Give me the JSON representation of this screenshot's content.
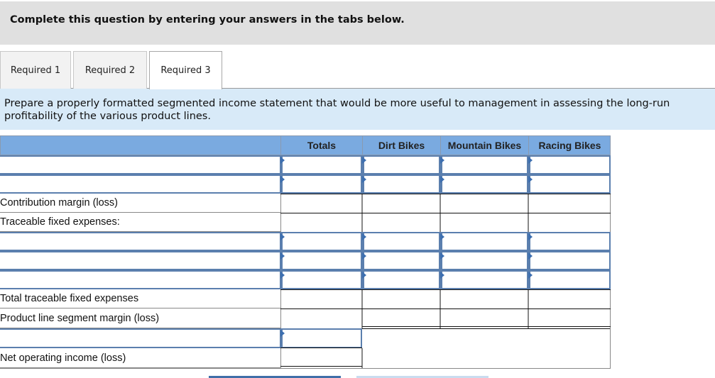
{
  "banner": {
    "text": "Complete this question by entering your answers in the tabs below."
  },
  "tabs": [
    {
      "label": "Required 1",
      "active": false
    },
    {
      "label": "Required 2",
      "active": false
    },
    {
      "label": "Required 3",
      "active": true
    }
  ],
  "instructions": {
    "text": "Prepare a properly formatted segmented income statement that would be more useful to management in assessing the long-run profitability of the various product lines."
  },
  "table": {
    "columns": [
      "Totals",
      "Dirt Bikes",
      "Mountain Bikes",
      "Racing Bikes"
    ],
    "rows": [
      {
        "type": "input",
        "label": "",
        "values": [
          "",
          "",
          "",
          ""
        ]
      },
      {
        "type": "input",
        "label": "",
        "values": [
          "",
          "",
          "",
          ""
        ]
      },
      {
        "type": "static",
        "label": "Contribution margin (loss)",
        "values": [
          "",
          "",
          "",
          ""
        ]
      },
      {
        "type": "static",
        "label": "Traceable fixed expenses:",
        "values": [
          "",
          "",
          "",
          ""
        ]
      },
      {
        "type": "input",
        "label": "",
        "values": [
          "",
          "",
          "",
          ""
        ]
      },
      {
        "type": "input",
        "label": "",
        "values": [
          "",
          "",
          "",
          ""
        ]
      },
      {
        "type": "input",
        "label": "",
        "values": [
          "",
          "",
          "",
          ""
        ]
      },
      {
        "type": "static",
        "label": "Total traceable fixed expenses",
        "values": [
          "",
          "",
          "",
          ""
        ]
      },
      {
        "type": "static",
        "label": "Product line segment margin (loss)",
        "values": [
          "",
          "",
          "",
          ""
        ]
      },
      {
        "type": "input",
        "label": "",
        "values": [
          ""
        ]
      },
      {
        "type": "static",
        "label": "Net operating income (loss)",
        "values": [
          ""
        ]
      }
    ]
  },
  "colors": {
    "banner_bg": "#e0e0e0",
    "instructions_bg": "#d8eaf8",
    "header_bg": "#7aaae0",
    "input_border": "#5b7fae"
  }
}
